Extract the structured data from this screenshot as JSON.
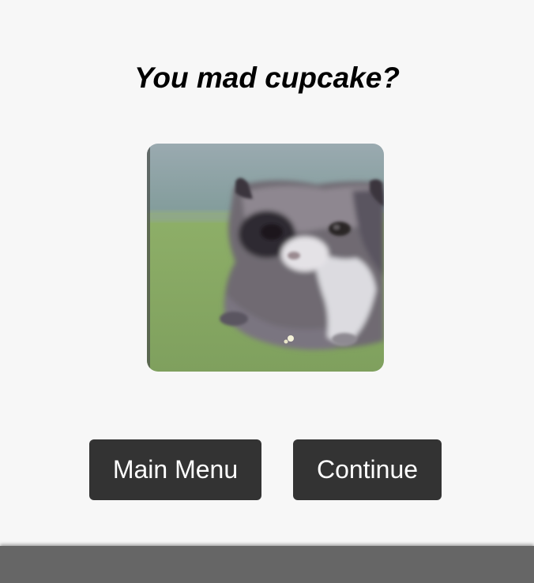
{
  "dialog": {
    "title": "You mad cupcake?",
    "image_subject": "cat-photo"
  },
  "buttons": {
    "main_menu_label": "Main Menu",
    "continue_label": "Continue"
  },
  "colors": {
    "background": "#f7f7f7",
    "button_bg": "#333333",
    "button_text": "#ffffff",
    "bottom_bar": "#666666"
  }
}
